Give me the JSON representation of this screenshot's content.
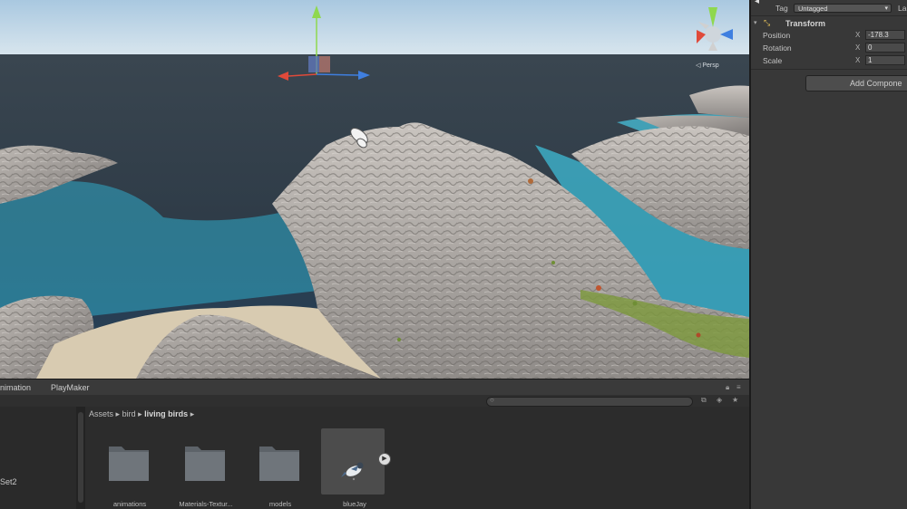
{
  "scene": {
    "gizmo_label": "◁ Persp"
  },
  "inspector": {
    "tag_label": "Tag",
    "tag_value": "Untagged",
    "layer_label": "La",
    "transform_title": "Transform",
    "position_label": "Position",
    "position_x": "-178.3",
    "rotation_label": "Rotation",
    "rotation_x": "0",
    "scale_label": "Scale",
    "scale_x": "1",
    "axis_x": "X",
    "add_component": "Add Compone"
  },
  "bottom": {
    "tabs": [
      "nimation",
      "PlayMaker"
    ],
    "left_item": "Set2",
    "breadcrumb": {
      "root": "Assets",
      "sep": "▸",
      "mid": "bird",
      "current": "living birds"
    },
    "assets": [
      {
        "label": "animations",
        "icon": "folder-icon"
      },
      {
        "label": "Materials-Textur...",
        "icon": "folder-icon"
      },
      {
        "label": "models",
        "icon": "folder-icon"
      },
      {
        "label": "blueJay",
        "icon": "bird-prefab-icon"
      }
    ]
  }
}
